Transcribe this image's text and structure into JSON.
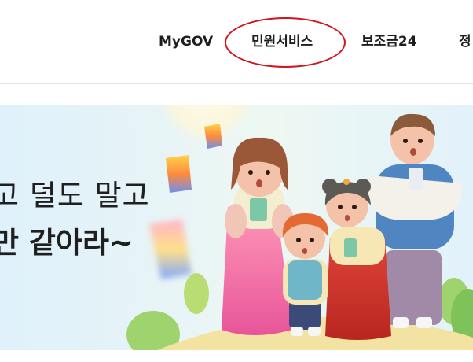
{
  "nav": {
    "items": [
      {
        "label": "MyGOV"
      },
      {
        "label": "민원서비스"
      },
      {
        "label": "보조금24"
      },
      {
        "label": "정"
      }
    ],
    "highlighted_index": 1,
    "highlight_color": "#d0151d"
  },
  "banner": {
    "headline_line1": "고 덜도 말고",
    "headline_line2": "만 같아라~",
    "illustration": "family-in-hanbok-chuseok",
    "lantern_icons": [
      "sky-lantern-icon",
      "sky-lantern-icon",
      "sky-lantern-icon"
    ]
  }
}
